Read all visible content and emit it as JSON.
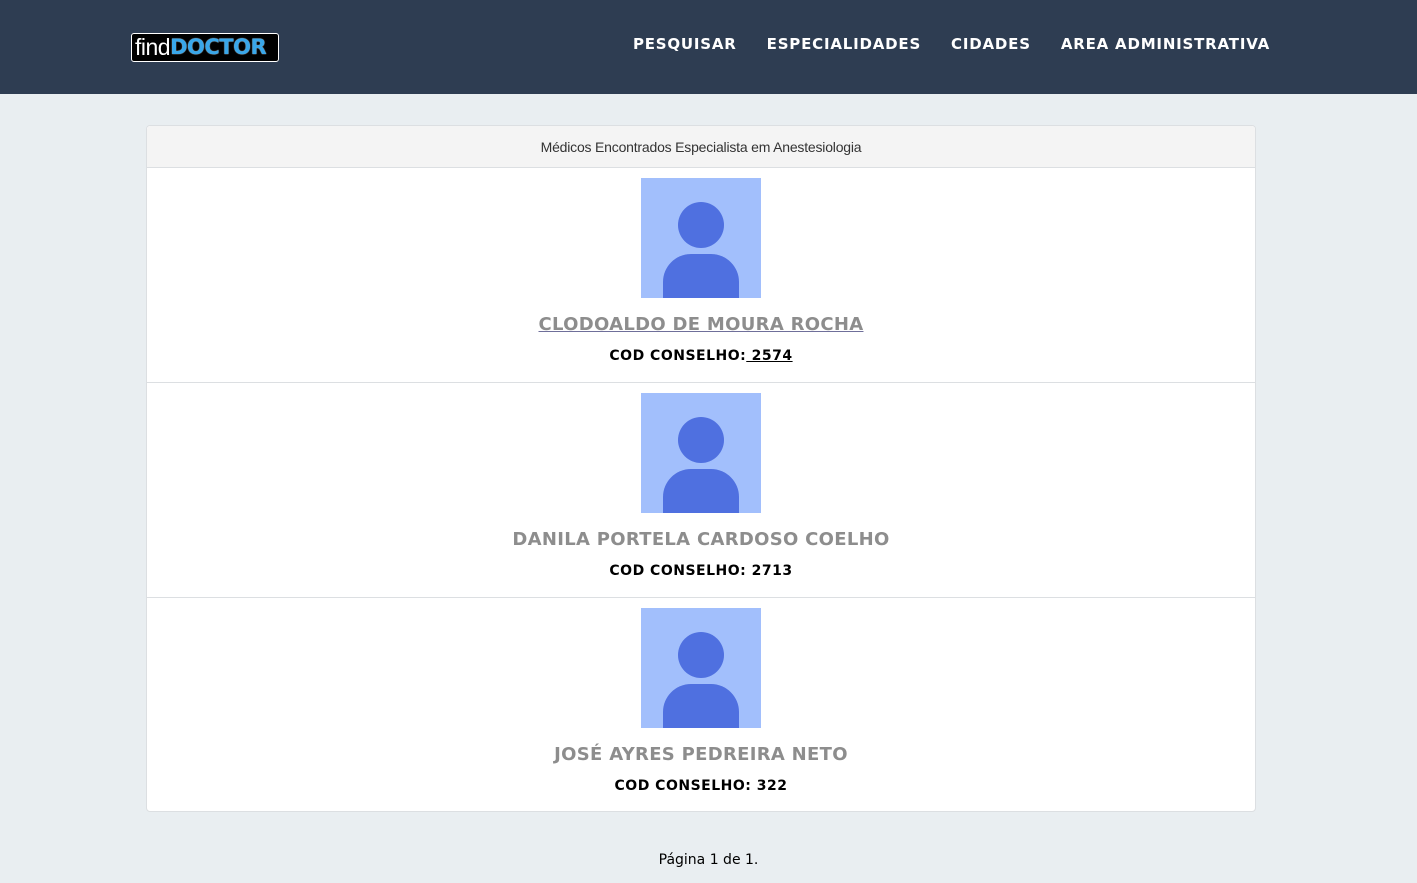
{
  "header": {
    "logo": {
      "find": "find",
      "doctor": "DOCTOR"
    },
    "nav": [
      "PESQUISAR",
      "ESPECIALIDADES",
      "CIDADES",
      "AREA ADMINISTRATIVA"
    ]
  },
  "panel": {
    "heading": "Médicos Encontrados Especialista em Anestesiologia",
    "doctors": [
      {
        "name": "CLODOALDO DE MOURA ROCHA",
        "cod_label": "COD CONSELHO:",
        "cod_value": " 2574",
        "avatar_icon": "user-avatar-icon"
      },
      {
        "name": "DANILA PORTELA CARDOSO COELHO",
        "cod_label": "COD CONSELHO:",
        "cod_value": " 2713",
        "avatar_icon": "user-avatar-icon"
      },
      {
        "name": "JOSÉ AYRES PEDREIRA NETO",
        "cod_label": "COD CONSELHO:",
        "cod_value": " 322",
        "avatar_icon": "user-avatar-icon"
      }
    ]
  },
  "pagination": {
    "text": "Página 1 de 1."
  },
  "colors": {
    "navbar": "#2e3d52",
    "background": "#e9eef1",
    "avatar_bg": "#a2bffc",
    "avatar_fg": "#4f70e0",
    "logo_accent": "#39a7ea"
  }
}
